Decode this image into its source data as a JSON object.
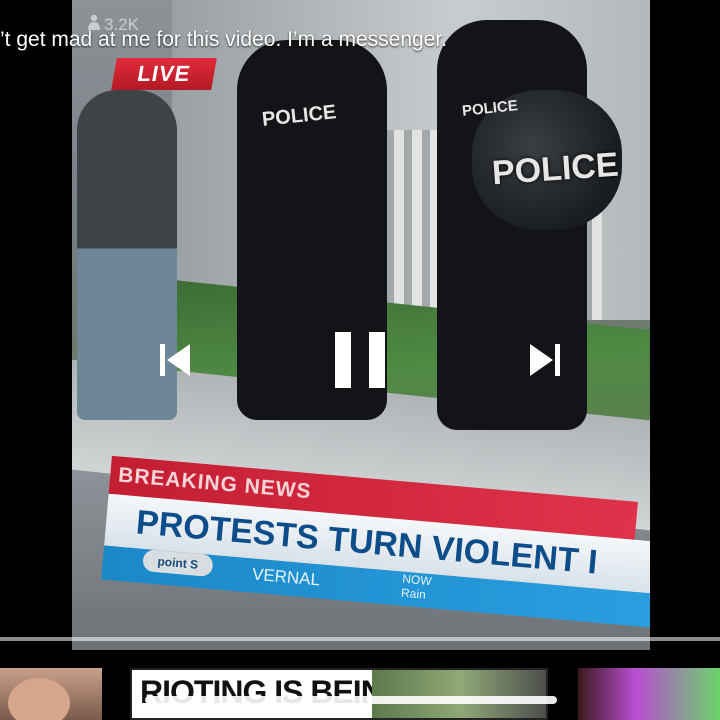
{
  "video": {
    "caption": "’t get mad at me for this video. I’m a messenger.",
    "view_count": "3.2K",
    "live_label": "LIVE",
    "police_labels": [
      "POLICE",
      "POLICE",
      "POLICE"
    ],
    "lower_third": {
      "breaking": "BREAKING NEWS",
      "headline": "PROTESTS TURN VIOLENT I",
      "station": "point S",
      "location": "VERNAL",
      "weather_now": "NOW",
      "weather_cond": "Rain"
    }
  },
  "controls": {
    "prev_icon": "skip-previous-icon",
    "pause_icon": "pause-icon",
    "next_icon": "skip-next-icon",
    "progress_fraction": 0.0
  },
  "thumbnails": {
    "title_text": "RIOTING IS BEING"
  }
}
